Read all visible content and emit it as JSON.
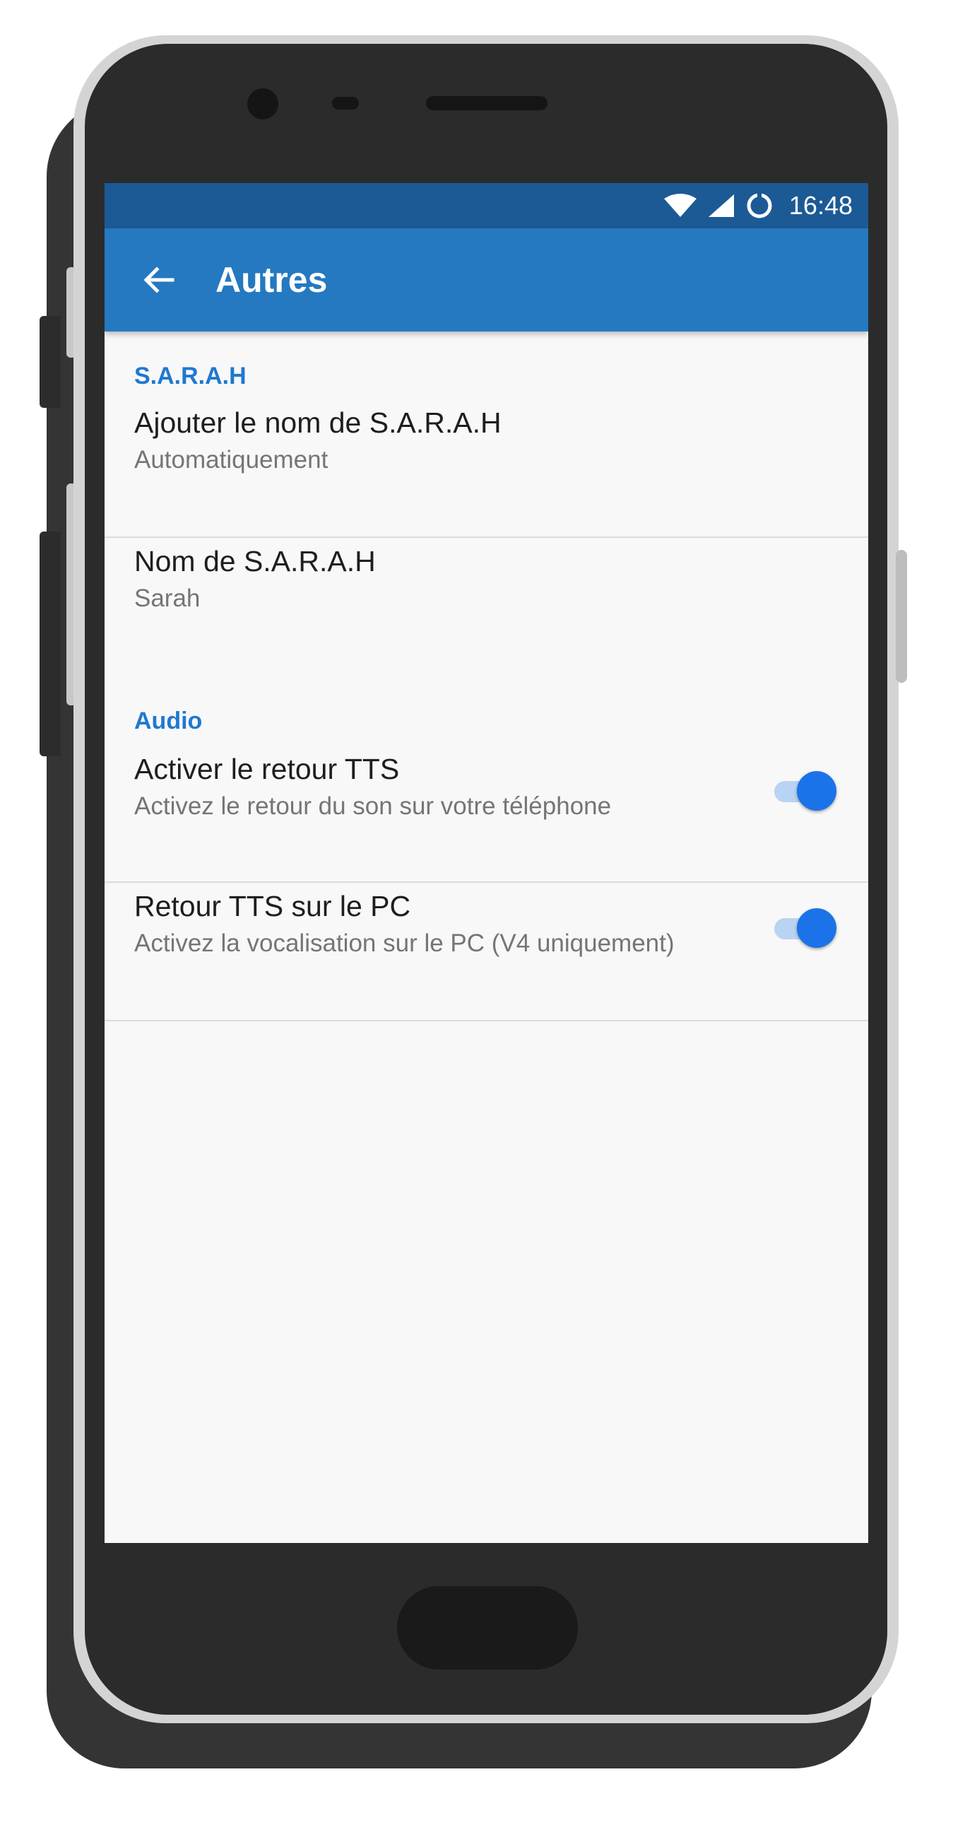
{
  "status_bar": {
    "time": "16:48",
    "icons": [
      "wifi-icon",
      "cell-signal-icon",
      "sync-icon"
    ]
  },
  "app_bar": {
    "back_icon": "arrow-back-icon",
    "title": "Autres"
  },
  "sections": [
    {
      "header": "S.A.R.A.H",
      "items": [
        {
          "title": "Ajouter le nom de S.A.R.A.H",
          "summary": "Automatiquement"
        },
        {
          "title": "Nom de S.A.R.A.H",
          "summary": "Sarah"
        }
      ]
    },
    {
      "header": "Audio",
      "items": [
        {
          "title": "Activer le retour TTS",
          "summary": "Activez le retour du son sur votre téléphone",
          "toggle": true
        },
        {
          "title": "Retour TTS sur le PC",
          "summary": "Activez la vocalisation sur le PC (V4 uniquement)",
          "toggle": true
        }
      ]
    }
  ],
  "colors": {
    "status_bar": "#1c5a96",
    "app_bar": "#2479c0",
    "accent": "#1f78d1",
    "toggle_thumb": "#1a73e8"
  }
}
